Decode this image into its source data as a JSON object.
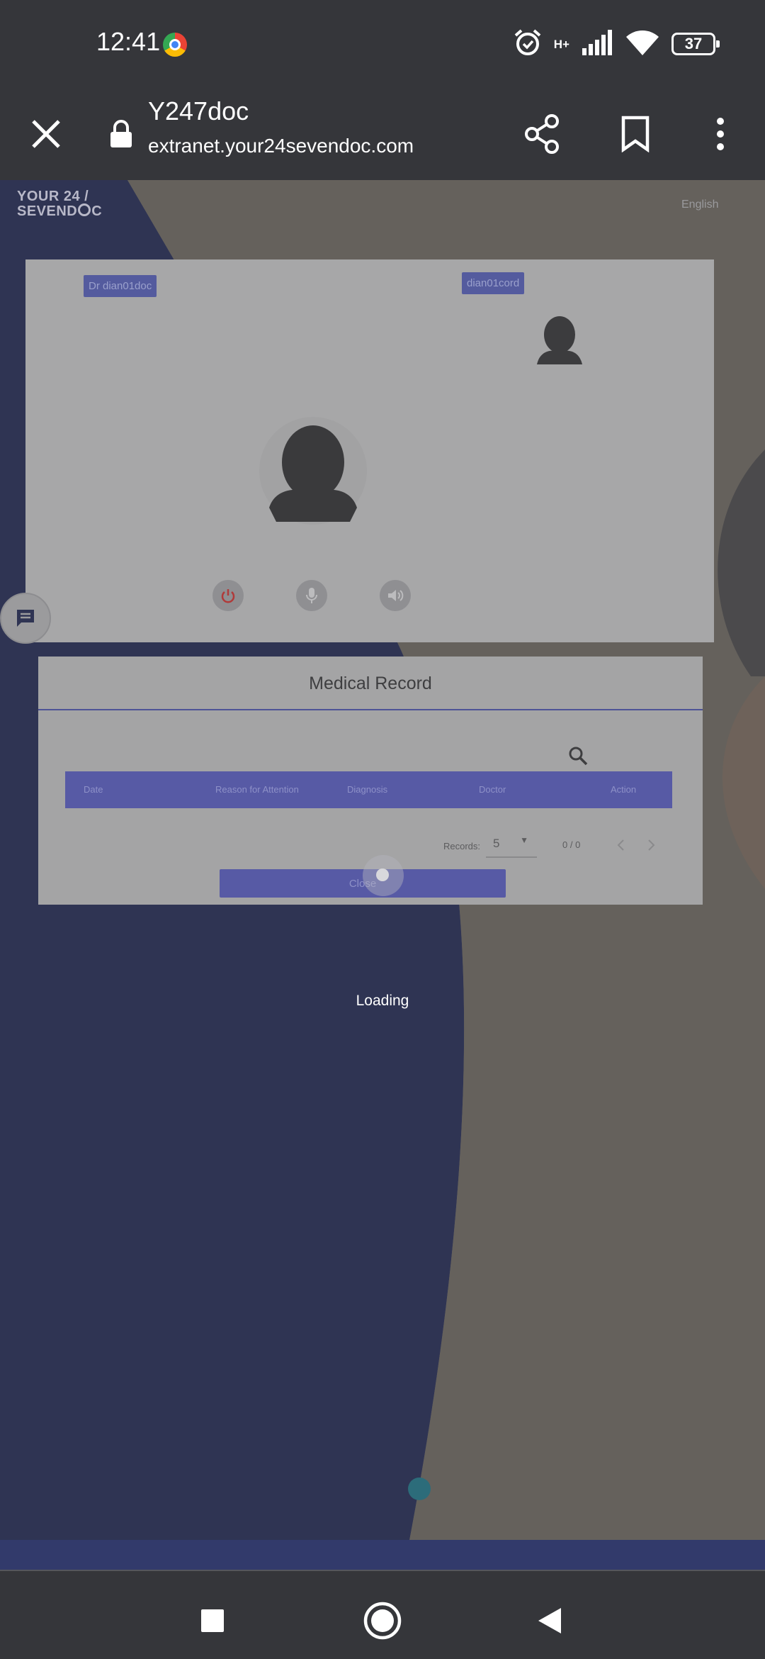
{
  "status_bar": {
    "time": "12:41",
    "network_label": "H+",
    "battery_level": "37",
    "icons": [
      "chrome-icon",
      "alarm-icon",
      "signal-icon",
      "wifi-icon",
      "battery-icon"
    ]
  },
  "browser": {
    "title": "Y247doc",
    "url": "extranet.your24sevendoc.com",
    "icons": [
      "close-icon",
      "lock-icon",
      "share-icon",
      "bookmark-icon",
      "more-icon"
    ]
  },
  "site": {
    "logo_line1": "YOUR 24 /",
    "logo_line2": "SEVEND",
    "logo_line2_tail": "C",
    "language": "English"
  },
  "video_call": {
    "doctor_tag": "Dr dian01doc",
    "patient_tag": "dian01cord",
    "controls": [
      "power-icon",
      "microphone-icon",
      "speaker-icon"
    ]
  },
  "medical_record": {
    "title": "Medical Record",
    "columns": [
      "Date",
      "Reason for Attention",
      "Diagnosis",
      "Doctor",
      "Action"
    ],
    "records_label": "Records:",
    "records_value": "5",
    "pagination": "0 / 0",
    "close_label": "Close"
  },
  "loading_text": "Loading",
  "colors": {
    "brand_blue": "#575aa5",
    "dark_blue": "#2f3453",
    "system_bar": "#35363a",
    "power_red": "#b03a3a"
  }
}
